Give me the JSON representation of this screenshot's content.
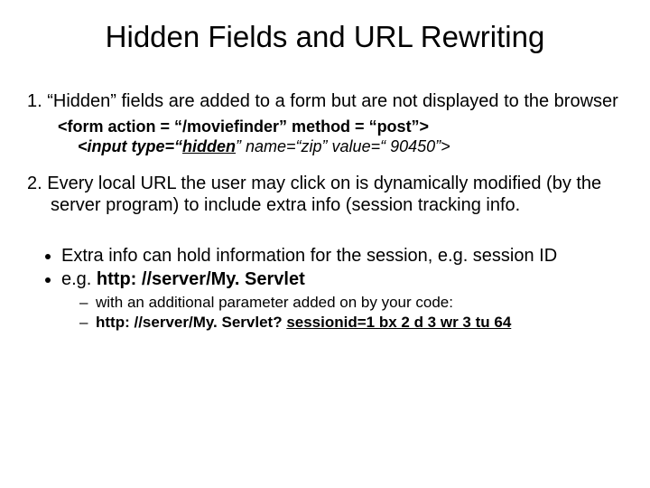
{
  "title": "Hidden Fields and URL Rewriting",
  "item1": "1. “Hidden” fields are added to a form but are not displayed to the browser",
  "code": {
    "line1_pre": "<form action = “/moviefinder” method = “post”>",
    "line2_pre": "<input type=“",
    "line2_kw": "hidden",
    "line2_post": "” name=“zip” value=“ 90450”>"
  },
  "item2": "2. Every local URL the user may click on is dynamically modified (by the server program) to include extra info (session tracking info.",
  "bullet1": "Extra info can hold information for the session, e.g. session ID",
  "bullet2_pre": "e.g.  ",
  "bullet2_url": "http: //server/My. Servlet",
  "sub1": "with an additional parameter added on by your code:",
  "sub2_pre": "http: //server/My. Servlet? ",
  "sub2_kw": "sessionid=1 bx 2 d 3 wr 3 tu 64"
}
